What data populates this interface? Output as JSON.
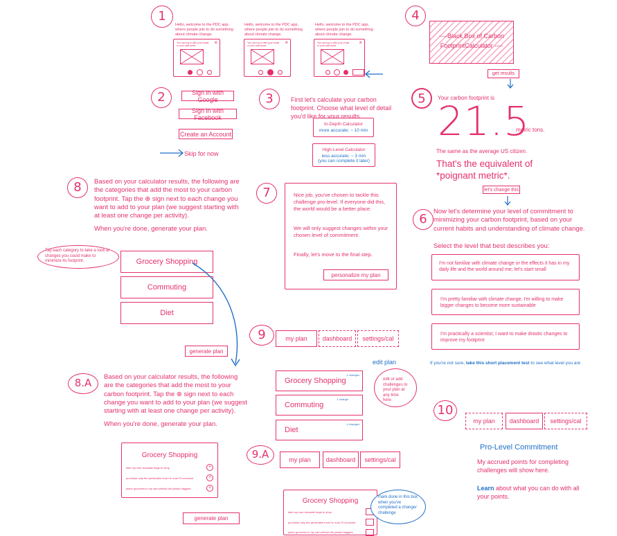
{
  "steps": {
    "s1": "1",
    "s2": "2",
    "s3": "3",
    "s4": "4",
    "s5": "5",
    "s6": "6",
    "s7": "7",
    "s8": "8",
    "s8a": "8.A",
    "s9": "9",
    "s9a": "9.A",
    "s10": "10"
  },
  "welcome": {
    "text": "Hello, welcome to the PDC app, where people join to do something about climate change.",
    "popup_header": "You can log in with your email or your username",
    "close": "×"
  },
  "signin": {
    "google": "Sign in with Google",
    "facebook": "Sign in with Facebook",
    "create": "Create an Account",
    "skip": "Skip for now"
  },
  "calc": {
    "intro": "First let's calculate your carbon footprint. Choose what level of detail you'd like for your results.",
    "indepth_title": "In-Depth Calculator",
    "indepth_sub": "more accurate; ~ 10 min",
    "highlevel_title": "High-Level Calculator",
    "highlevel_sub1": "less accurate; ~ 3 min",
    "highlevel_sub2": "(you can complete it later)"
  },
  "blackbox": {
    "line1": "----Black Box of Carbon",
    "line2": "FootprintCalculator ----",
    "get_results": "get results"
  },
  "result": {
    "label": "Your carbon footprint is",
    "value": "21.5",
    "unit": "metric tons.",
    "average": "The same as the average US citizen.",
    "equivalent1": "That's the equivalent of",
    "equivalent2": "*poignant metric*.",
    "change_btn": "let's change this"
  },
  "commitment": {
    "intro": "Now let's determine your level of commitment to minimizing your carbon footprint, based on your current habits and understanding of climate change.",
    "select": "Select the level that best describes you:",
    "opt1": "I'm not familiar with climate change or the effects it has in my daily life and the world around me; let's start small",
    "opt2": "I'm pretty familiar with climate change, I'm willing to make bigger changes to become more sustainable",
    "opt3": "I'm practically a scientist; I want to make drastic changes to improve my footprint",
    "footer_pre": "If you're not sure, ",
    "footer_link": "take this short placement test",
    "footer_post": " to see what level you are"
  },
  "step7": {
    "p1": "Nice job, you've chosen to tackle this challenge pro-level. If everyone did this, the world would be a better place.",
    "p2": "We will only suggest changes within your chosen level of commitment.",
    "p3": "Finally, let's move to the final step.",
    "button": "personalize my plan"
  },
  "step8": {
    "intro": "Based on your calculator results, the following are the categories that add the most to your carbon footprint. Tap the ⊕ sign next to each change you want to add to your plan (we suggest starting with at least one change per activity).",
    "done": "When you're done, generate your plan.",
    "tip": "Tap each category to take a look at changes you could make to minimize its footprint.",
    "cat1": "Grocery Shopping",
    "cat2": "Commuting",
    "cat3": "Diet",
    "generate": "generate plan"
  },
  "step8a": {
    "intro": "Based on your calculator results, the following are the categories that add the most to your carbon footprint. Tap the ⊕ sign next to each change you want to add to your plan (we suggest starting with at least one change per activity).",
    "done": "When you're done, generate your plan.",
    "card_title": "Grocery Shopping",
    "item1": "take my own reusable bags to shop",
    "item2": "purchase only the perishable food I'm sure I'll consume",
    "item3": "place groceries in my cart without the plastic baggies",
    "generate": "generate plan"
  },
  "tabs": {
    "plan": "my plan",
    "dashboard": "dashboard",
    "settings": "settings/cal"
  },
  "step9": {
    "edit": "edit plan",
    "cat1": "Grocery Shopping",
    "cat1_changes": "2 changes",
    "cat2": "Commuting",
    "cat2_changes": "1 change",
    "cat3": "Diet",
    "cat3_changes": "4 changes",
    "note": "edit or add challenges to your plan at any time here"
  },
  "step9a": {
    "card_title": "Grocery Shopping",
    "item1": "take my own reusable bags to shop",
    "item2": "purchase only the perishable food I'm sure I'll consume",
    "item3": "place groceries in my cart without the plastic baggies",
    "note": "mark done in this box when you've completed a change/ challenge"
  },
  "step10": {
    "title": "Pro-Level Commitment",
    "p1": "My accrued points for completing challenges will show here.",
    "learn": "Learn",
    "p2": " about what you can do with all your points."
  },
  "colors": {
    "accent": "#e4306a",
    "link": "#1f6fc7"
  }
}
